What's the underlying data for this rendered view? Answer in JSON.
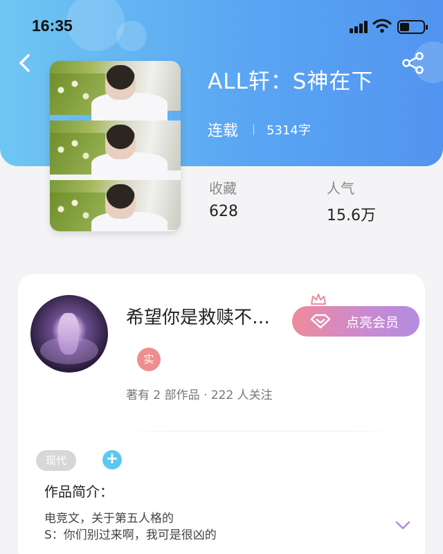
{
  "status_bar": {
    "time": "16:35"
  },
  "book": {
    "title": "ALL轩：S神在下",
    "status": "连载",
    "word_count": "5314字",
    "stats": [
      {
        "label": "收藏",
        "value": "628"
      },
      {
        "label": "人气",
        "value": "15.6万"
      }
    ]
  },
  "author": {
    "name": "希望你是救赎不…",
    "badge": "实",
    "meta": "著有 2 部作品 · 222 人关注",
    "vip_button": "点亮会员"
  },
  "tags": {
    "items": [
      "现代"
    ],
    "add": "+"
  },
  "intro": {
    "title": "作品简介：",
    "lines": [
      "电竞文，关于第五人格的",
      "S：你们别过来啊，我可是很凶的"
    ]
  },
  "colors": {
    "header_start": "#6fc6f2",
    "header_end": "#5294f0",
    "tag_add": "#5cc8f0",
    "badge_real": "#ee8e8e"
  },
  "icons": {
    "back": "chevron-left-icon",
    "share": "share-icon",
    "vip": "diamond-icon",
    "crown": "crown-icon",
    "expand": "chevron-down-icon"
  }
}
